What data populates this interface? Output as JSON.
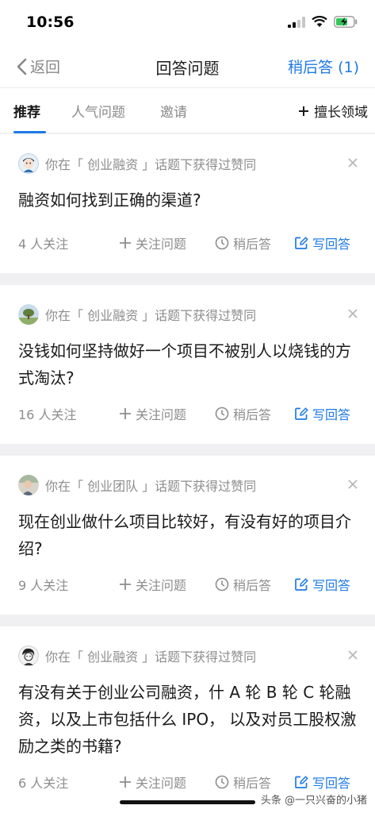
{
  "status_bar": {
    "time": "10:56"
  },
  "nav": {
    "back_label": "返回",
    "title": "回答问题",
    "later_label": "稍后答 (1)"
  },
  "tabs": [
    {
      "label": "推荐"
    },
    {
      "label": "人气问题"
    },
    {
      "label": "邀请"
    }
  ],
  "domain_label": "擅长领域",
  "cards": [
    {
      "meta": "你在「 创业融资 」话题下获得过赞同",
      "title": "融资如何找到正确的渠道?",
      "follow_count": "4 人关注",
      "follow_label": "关注问题",
      "later_label": "稍后答",
      "write_label": "写回答"
    },
    {
      "meta": "你在「 创业融资 」话题下获得过赞同",
      "title": "没钱如何坚持做好一个项目不被别人以烧钱的方式淘汰?",
      "follow_count": "16 人关注",
      "follow_label": "关注问题",
      "later_label": "稍后答",
      "write_label": "写回答"
    },
    {
      "meta": "你在「 创业团队 」话题下获得过赞同",
      "title": "现在创业做什么项目比较好，有没有好的项目介绍?",
      "follow_count": "9 人关注",
      "follow_label": "关注问题",
      "later_label": "稍后答",
      "write_label": "写回答"
    },
    {
      "meta": "你在「 创业融资 」话题下获得过赞同",
      "title": "有没有关于创业公司融资，什 A 轮 B 轮 C 轮融资，以及上市包括什么 IPO， 以及对员工股权激励之类的书籍?",
      "follow_count": "6 人关注",
      "follow_label": "关注问题",
      "later_label": "稍后答",
      "write_label": "写回答"
    }
  ],
  "watermark": "头条 @一只兴奋的小猪",
  "colors": {
    "accent": "#1e7ae6",
    "muted": "#8d8d8d",
    "separator": "#f0f0f2"
  }
}
